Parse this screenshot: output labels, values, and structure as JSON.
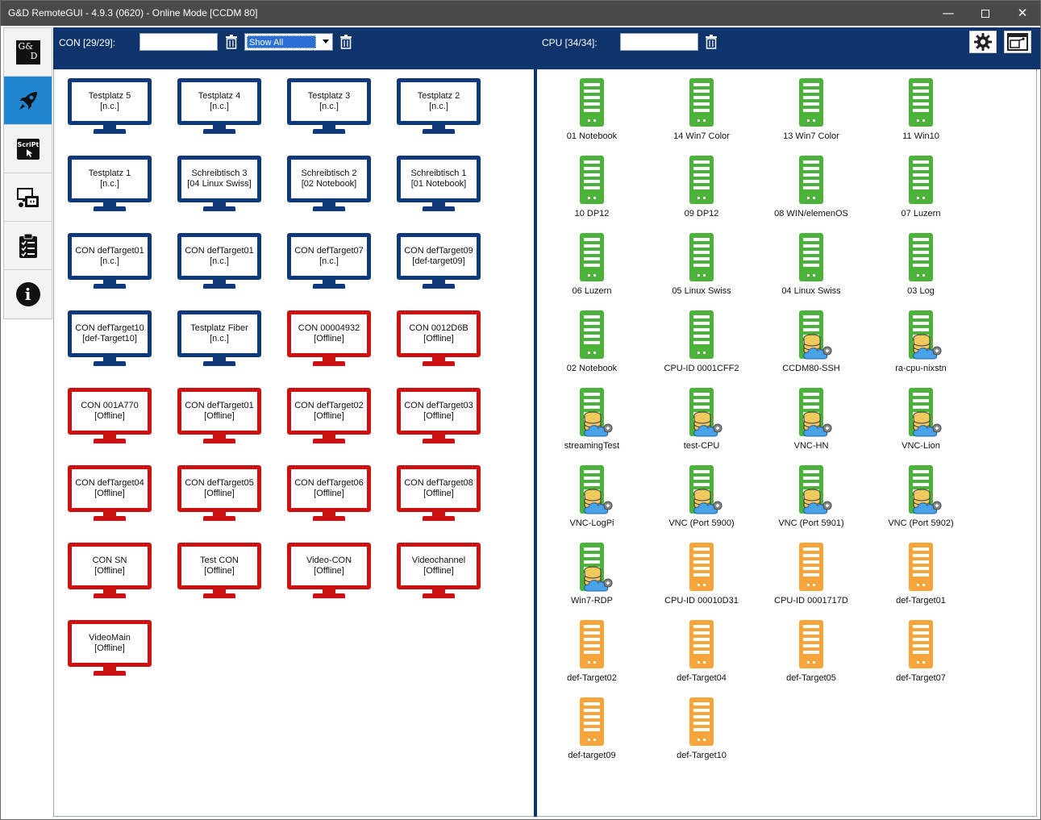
{
  "window": {
    "title": "G&D RemoteGUI - 4.9.3 (0620) - Online Mode [CCDM 80]",
    "min_glyph": "—",
    "close_glyph": "✕"
  },
  "sidebar": {
    "logo_text_top": "G&",
    "logo_text_bottom": "D",
    "items": [
      {
        "icon": "gd-logo-icon"
      },
      {
        "icon": "rocket-icon",
        "active": true
      },
      {
        "icon": "script-icon",
        "text": "ScriPt"
      },
      {
        "icon": "config-icon"
      },
      {
        "icon": "checklist-icon"
      },
      {
        "icon": "info-icon",
        "text": "i"
      }
    ]
  },
  "toolbar": {
    "con_label": "CON [29/29]:",
    "con_filter_value": "",
    "con_select_value": "Show All",
    "cpu_label": "CPU [34/34]:",
    "cpu_filter_value": ""
  },
  "colors": {
    "navy": "#0f346c",
    "online_border": "#0f3a7a",
    "offline_border": "#cc1111",
    "server_green": "#4bb33a",
    "server_orange": "#f7a43a",
    "active_blue": "#1f86cf"
  },
  "cons": [
    {
      "name": "Testplatz 5",
      "status": "[n.c.]",
      "state": "online"
    },
    {
      "name": "Testplatz 4",
      "status": "[n.c.]",
      "state": "online"
    },
    {
      "name": "Testplatz 3",
      "status": "[n.c.]",
      "state": "online"
    },
    {
      "name": "Testplatz 2",
      "status": "[n.c.]",
      "state": "online"
    },
    {
      "name": "Testplatz 1",
      "status": "[n.c.]",
      "state": "online"
    },
    {
      "name": "Schreibtisch 3",
      "status": "[04 Linux Swiss]",
      "state": "online"
    },
    {
      "name": "Schreibtisch 2",
      "status": "[02 Notebook]",
      "state": "online"
    },
    {
      "name": "Schreibtisch 1",
      "status": "[01 Notebook]",
      "state": "online"
    },
    {
      "name": "CON defTarget01",
      "status": "[n.c.]",
      "state": "online"
    },
    {
      "name": "CON defTarget01",
      "status": "[n.c.]",
      "state": "online"
    },
    {
      "name": "CON defTarget07",
      "status": "[n.c.]",
      "state": "online"
    },
    {
      "name": "CON defTarget09",
      "status": "[def-target09]",
      "state": "online"
    },
    {
      "name": "CON defTarget10",
      "status": "[def-Target10]",
      "state": "online"
    },
    {
      "name": "Testplatz Fiber",
      "status": "[n.c.]",
      "state": "online"
    },
    {
      "name": "CON 00004932",
      "status": "[Offline]",
      "state": "offline"
    },
    {
      "name": "CON 0012D6B",
      "status": "[Offline]",
      "state": "offline"
    },
    {
      "name": "CON 001A770",
      "status": "[Offline]",
      "state": "offline"
    },
    {
      "name": "CON defTarget01",
      "status": "[Offline]",
      "state": "offline"
    },
    {
      "name": "CON defTarget02",
      "status": "[Offline]",
      "state": "offline"
    },
    {
      "name": "CON defTarget03",
      "status": "[Offline]",
      "state": "offline"
    },
    {
      "name": "CON defTarget04",
      "status": "[Offline]",
      "state": "offline"
    },
    {
      "name": "CON defTarget05",
      "status": "[Offline]",
      "state": "offline"
    },
    {
      "name": "CON defTarget06",
      "status": "[Offline]",
      "state": "offline"
    },
    {
      "name": "CON defTarget08",
      "status": "[Offline]",
      "state": "offline"
    },
    {
      "name": "CON SN",
      "status": "[Offline]",
      "state": "offline"
    },
    {
      "name": "Test CON",
      "status": "[Offline]",
      "state": "offline"
    },
    {
      "name": "Video-CON",
      "status": "[Offline]",
      "state": "offline"
    },
    {
      "name": "Videochannel",
      "status": "[Offline]",
      "state": "offline"
    },
    {
      "name": "VideoMain",
      "status": "[Offline]",
      "state": "offline"
    }
  ],
  "cpus": [
    {
      "name": "01 Notebook",
      "color": "green",
      "overlay": false
    },
    {
      "name": "14 Win7 Color",
      "color": "green",
      "overlay": false
    },
    {
      "name": "13 Win7 Color",
      "color": "green",
      "overlay": false
    },
    {
      "name": "11 Win10",
      "color": "green",
      "overlay": false
    },
    {
      "name": "10 DP12",
      "color": "green",
      "overlay": false
    },
    {
      "name": "09 DP12",
      "color": "green",
      "overlay": false
    },
    {
      "name": "08 WIN/elemenOS",
      "color": "green",
      "overlay": false
    },
    {
      "name": "07 Luzern",
      "color": "green",
      "overlay": false
    },
    {
      "name": "06 Luzern",
      "color": "green",
      "overlay": false
    },
    {
      "name": "05 Linux Swiss",
      "color": "green",
      "overlay": false
    },
    {
      "name": "04 Linux Swiss",
      "color": "green",
      "overlay": false
    },
    {
      "name": "03 Log",
      "color": "green",
      "overlay": false
    },
    {
      "name": "02 Notebook",
      "color": "green",
      "overlay": false
    },
    {
      "name": "CPU-ID 0001CFF2",
      "color": "green",
      "overlay": false
    },
    {
      "name": "CCDM80-SSH",
      "color": "green",
      "overlay": true
    },
    {
      "name": "ra-cpu-nixstn",
      "color": "green",
      "overlay": true
    },
    {
      "name": "streamingTest",
      "color": "green",
      "overlay": true
    },
    {
      "name": "test-CPU",
      "color": "green",
      "overlay": true
    },
    {
      "name": "VNC-HN",
      "color": "green",
      "overlay": true
    },
    {
      "name": "VNC-Lion",
      "color": "green",
      "overlay": true
    },
    {
      "name": "VNC-LogPi",
      "color": "green",
      "overlay": true
    },
    {
      "name": "VNC (Port 5900)",
      "color": "green",
      "overlay": true
    },
    {
      "name": "VNC (Port 5901)",
      "color": "green",
      "overlay": true
    },
    {
      "name": "VNC (Port 5902)",
      "color": "green",
      "overlay": true
    },
    {
      "name": "Win7-RDP",
      "color": "green",
      "overlay": true
    },
    {
      "name": "CPU-ID 00010D31",
      "color": "orange",
      "overlay": false
    },
    {
      "name": "CPU-ID 0001717D",
      "color": "orange",
      "overlay": false
    },
    {
      "name": "def-Target01",
      "color": "orange",
      "overlay": false
    },
    {
      "name": "def-Target02",
      "color": "orange",
      "overlay": false
    },
    {
      "name": "def-Target04",
      "color": "orange",
      "overlay": false
    },
    {
      "name": "def-Target05",
      "color": "orange",
      "overlay": false
    },
    {
      "name": "def-Target07",
      "color": "orange",
      "overlay": false
    },
    {
      "name": "def-target09",
      "color": "orange",
      "overlay": false
    },
    {
      "name": "def-Target10",
      "color": "orange",
      "overlay": false
    }
  ]
}
